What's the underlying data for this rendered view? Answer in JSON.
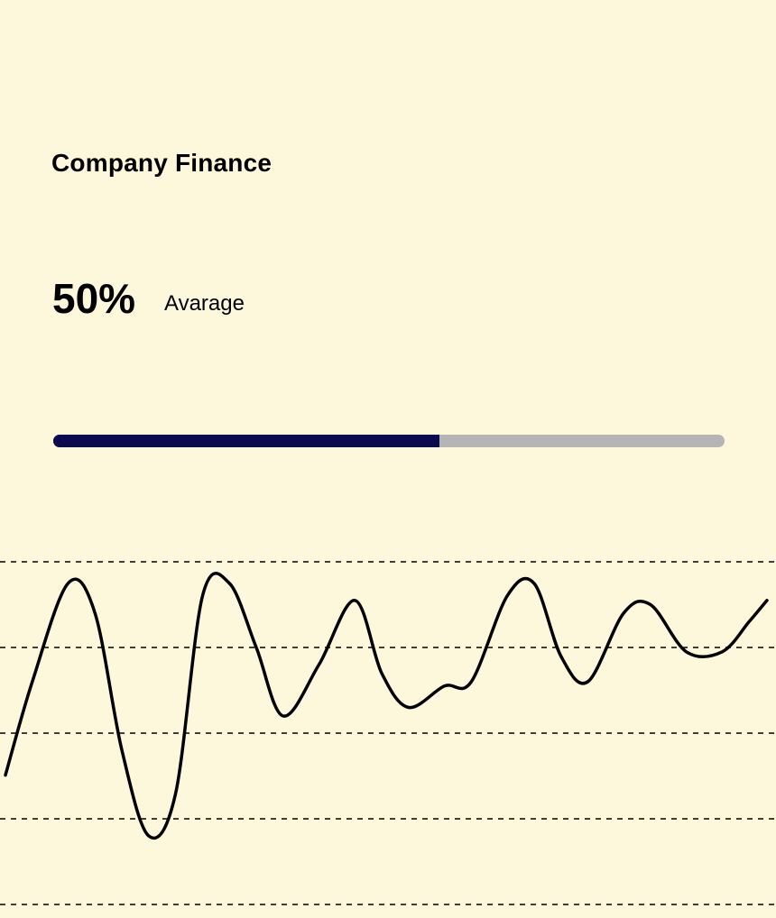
{
  "colors": {
    "background": "#fdf7dc",
    "progress_fill": "#0b0a4f",
    "progress_track": "#b5b5b5",
    "line": "#000000",
    "gridline": "#000000"
  },
  "card": {
    "title": "Company Finance",
    "stat_value": "50%",
    "stat_label": "Avarage",
    "progress": 0.575
  },
  "chart_data": {
    "type": "line",
    "smooth": true,
    "grid": "horizontal-dashed",
    "axes_visible": false,
    "ylim": [
      0,
      4
    ],
    "gridlines_y": [
      0,
      1,
      2,
      3,
      4
    ],
    "series": [
      {
        "points": [
          [
            0.0,
            1.51
          ],
          [
            0.3,
            2.6
          ],
          [
            0.7,
            3.75
          ],
          [
            1.0,
            3.4
          ],
          [
            1.3,
            1.8
          ],
          [
            1.6,
            0.8
          ],
          [
            1.9,
            1.3
          ],
          [
            2.2,
            3.6
          ],
          [
            2.5,
            3.75
          ],
          [
            2.8,
            3.0
          ],
          [
            3.1,
            2.2
          ],
          [
            3.5,
            2.8
          ],
          [
            3.9,
            3.55
          ],
          [
            4.2,
            2.7
          ],
          [
            4.5,
            2.3
          ],
          [
            4.9,
            2.55
          ],
          [
            5.2,
            2.6
          ],
          [
            5.6,
            3.6
          ],
          [
            5.9,
            3.75
          ],
          [
            6.2,
            2.9
          ],
          [
            6.5,
            2.6
          ],
          [
            6.9,
            3.4
          ],
          [
            7.2,
            3.5
          ],
          [
            7.6,
            2.95
          ],
          [
            8.0,
            2.95
          ],
          [
            8.3,
            3.3
          ],
          [
            8.5,
            3.55
          ]
        ]
      }
    ]
  },
  "icons": {}
}
